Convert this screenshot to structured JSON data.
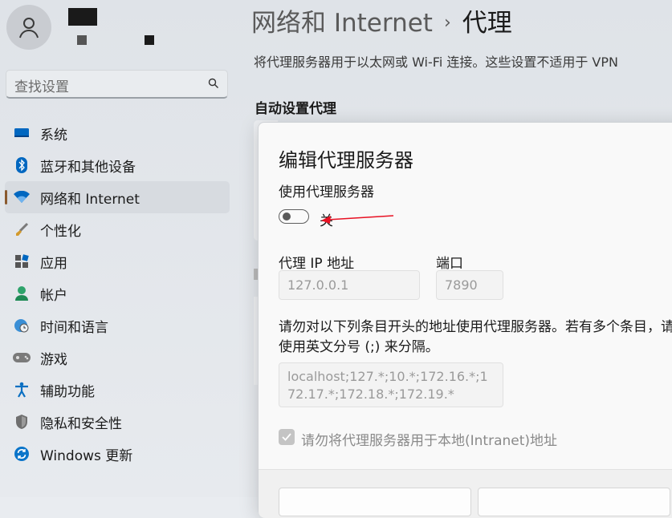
{
  "sidebar": {
    "search_placeholder": "查找设置",
    "items": [
      {
        "label": "系统",
        "icon": "monitor-icon"
      },
      {
        "label": "蓝牙和其他设备",
        "icon": "bluetooth-icon"
      },
      {
        "label": "网络和 Internet",
        "icon": "wifi-icon",
        "active": true
      },
      {
        "label": "个性化",
        "icon": "brush-icon"
      },
      {
        "label": "应用",
        "icon": "apps-icon"
      },
      {
        "label": "帐户",
        "icon": "account-icon"
      },
      {
        "label": "时间和语言",
        "icon": "globe-clock-icon"
      },
      {
        "label": "游戏",
        "icon": "gamepad-icon"
      },
      {
        "label": "辅助功能",
        "icon": "accessibility-icon"
      },
      {
        "label": "隐私和安全性",
        "icon": "shield-icon"
      },
      {
        "label": "Windows 更新",
        "icon": "update-icon"
      }
    ]
  },
  "header": {
    "parent": "网络和 Internet",
    "separator": "›",
    "current": "代理"
  },
  "main": {
    "description": "将代理服务器用于以太网或 Wi-Fi 连接。这些设置不适用于 VPN",
    "auto_section": "自动设置代理"
  },
  "dialog": {
    "title": "编辑代理服务器",
    "use_proxy_label": "使用代理服务器",
    "toggle_state": "关",
    "ip_label": "代理 IP 地址",
    "ip_value": "127.0.0.1",
    "port_label": "端口",
    "port_value": "7890",
    "exceptions_label": "请勿对以下列条目开头的地址使用代理服务器。若有多个条目，请使用英文分号 (;) 来分隔。",
    "exceptions_value": "localhost;127.*;10.*;172.16.*;172.17.*;172.18.*;172.19.*",
    "local_checkbox_label": "请勿将代理服务器用于本地(Intranet)地址"
  },
  "colors": {
    "accent_wifi": "#0067c0",
    "annotation_arrow": "#e81123"
  }
}
